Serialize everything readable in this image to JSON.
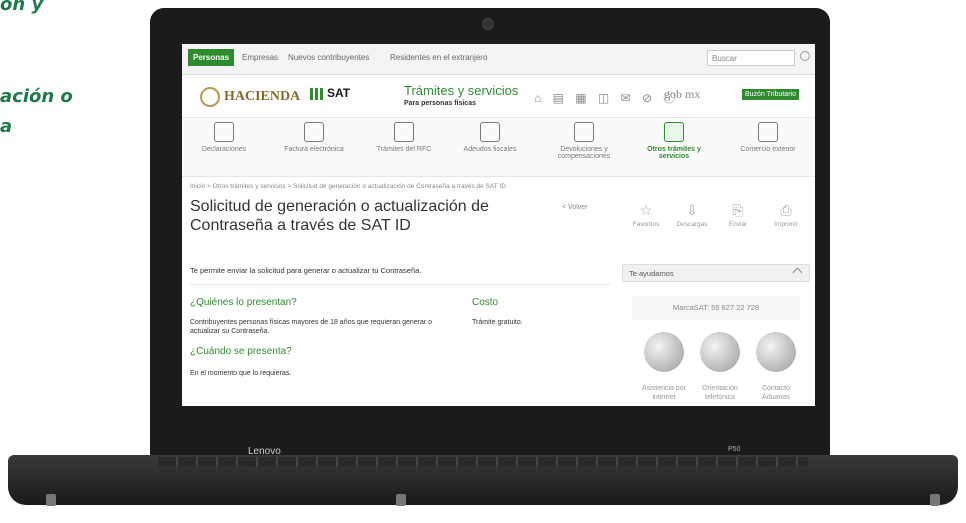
{
  "side": {
    "line1": "ón y",
    "line2": "ación o",
    "line3": "a"
  },
  "laptop": {
    "brand": "Lenovo",
    "model": "P50"
  },
  "topnav": {
    "items": [
      "Personas",
      "Empresas",
      "Nuevos contribuyentes",
      "Residentes en el extranjero"
    ],
    "search_placeholder": "Buscar"
  },
  "header": {
    "hacienda": "HACIENDA",
    "sat": "SAT",
    "tramites": "Trámites y servicios",
    "tramites_sub": "Para personas físicas",
    "icons": "⌂ ▤ ▦ ◫ ✉ ⊘ ⓘ",
    "gobmx": "gob mx",
    "buzon": "Buzón Tributario"
  },
  "categories": [
    {
      "label": "Declaraciones",
      "icon": "calculator-icon"
    },
    {
      "label": "Factura electrónica",
      "icon": "document-icon"
    },
    {
      "label": "Trámites del RFC",
      "icon": "id-card-icon"
    },
    {
      "label": "Adeudos fiscales",
      "icon": "coins-icon"
    },
    {
      "label": "Devoluciones y compensaciones",
      "icon": "hand-click-icon"
    },
    {
      "label": "Otros trámites y servicios",
      "icon": "monitor-icon"
    },
    {
      "label": "Comercio exterior",
      "icon": "bulb-icon"
    }
  ],
  "breadcrumb": "Inicio > Otros trámites y servicios > Solicitud de generación o actualización de Contraseña a través de SAT ID",
  "page": {
    "title": "Solicitud de generación o actualización de Contraseña a través de SAT ID",
    "volver": "< Volver",
    "description": "Te permite enviar la solicitud para generar o actualizar tu Contraseña.",
    "q1": "¿Quiénes lo presentan?",
    "a1": "Contribuyentes personas físicas mayores de 18 años que requieran generar o actualizar su Contraseña.",
    "costo_h": "Costo",
    "costo_v": "Trámite gratuito.",
    "q2": "¿Cuándo se presenta?",
    "a2": "En el momento que lo requieras."
  },
  "tools": [
    {
      "label": "Favoritos",
      "glyph": "☆"
    },
    {
      "label": "Descargas",
      "glyph": "⇩"
    },
    {
      "label": "Enviar",
      "glyph": "⎘"
    },
    {
      "label": "Imprimir",
      "glyph": "⎙"
    }
  ],
  "help": {
    "title": "Te ayudamos",
    "marca": "MarcaSAT: 55 627 22 728",
    "channels": [
      "Asistencia por internet",
      "Orientación telefónica",
      "Contacto Aduanas"
    ]
  }
}
